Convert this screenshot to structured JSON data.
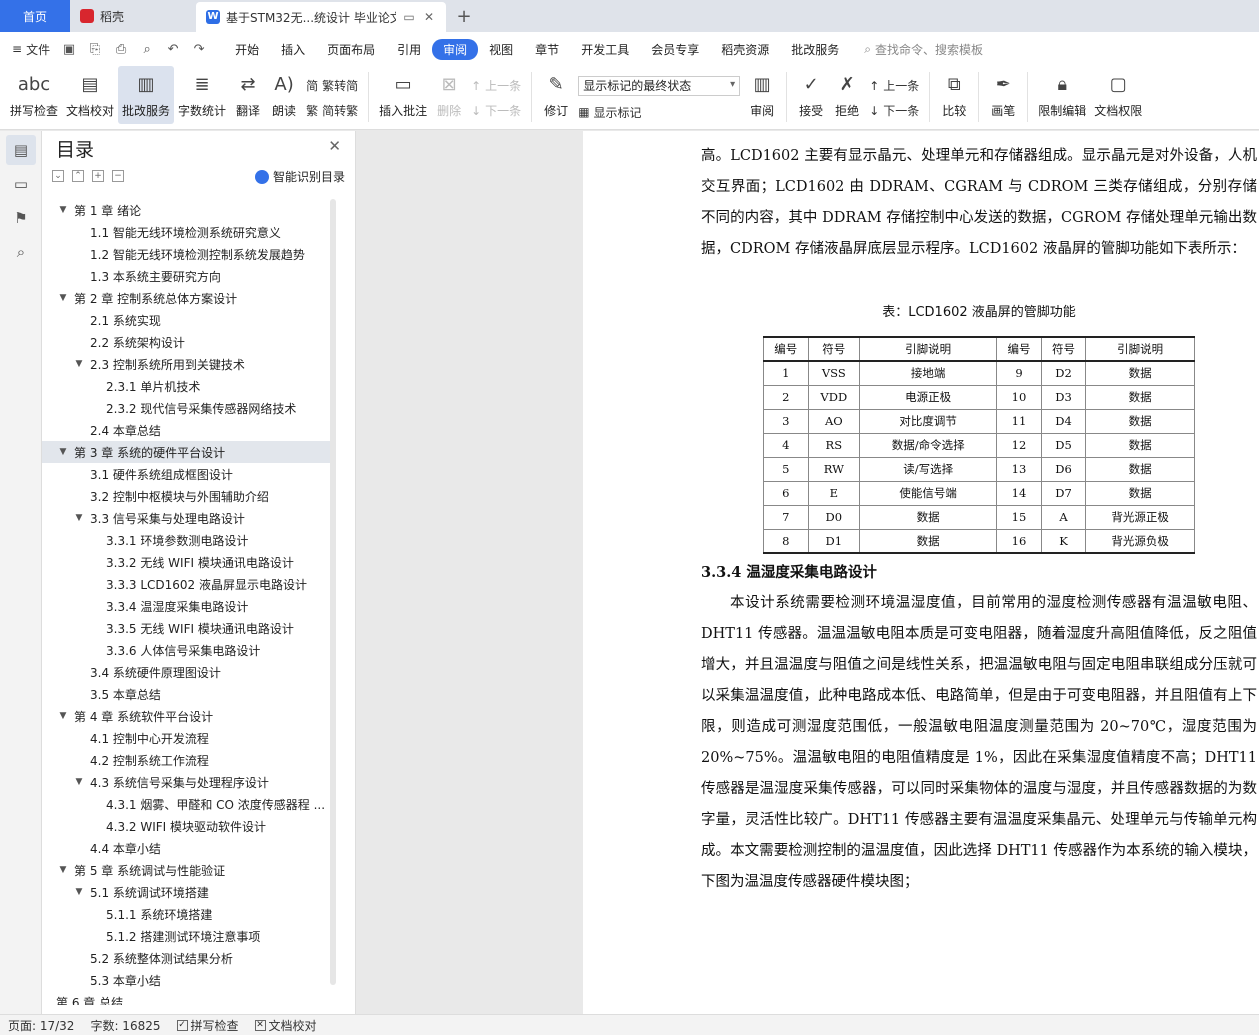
{
  "tabs": {
    "home": "首页",
    "daoke": "稻壳",
    "doc": "基于STM32无...统设计 毕业论文"
  },
  "menu": {
    "file": "文件",
    "tabs": [
      "开始",
      "插入",
      "页面布局",
      "引用",
      "审阅",
      "视图",
      "章节",
      "开发工具",
      "会员专享",
      "稻壳资源",
      "批改服务"
    ],
    "active": "审阅",
    "search": "查找命令、搜索模板"
  },
  "ribbon": {
    "spell": "拼写检查",
    "doc_check": "文档校对",
    "grading": "批改服务",
    "wordcount": "字数统计",
    "translate": "翻译",
    "read": "朗读",
    "trad": "繁转简",
    "simp": "简转繁",
    "insert_comment": "插入批注",
    "delete": "删除",
    "prev": "上一条",
    "next": "下一条",
    "revise": "修订",
    "markup_select": "显示标记的最终状态",
    "show_markup": "显示标记",
    "review": "审阅",
    "accept": "接受",
    "reject": "拒绝",
    "prev2": "上一条",
    "next2": "下一条",
    "compare": "比较",
    "pen": "画笔",
    "restrict": "限制编辑",
    "doc_perm": "文档权限"
  },
  "toc": {
    "title": "目录",
    "smart": "智能识别目录",
    "items": [
      {
        "level": 1,
        "text": "第 1 章  绪论",
        "caret": "v"
      },
      {
        "level": 2,
        "text": "1.1 智能无线环境检测系统研究意义",
        "caret": ""
      },
      {
        "level": 2,
        "text": "1.2 智能无线环境检测控制系统发展趋势",
        "caret": ""
      },
      {
        "level": 2,
        "text": "1.3 本系统主要研究方向",
        "caret": ""
      },
      {
        "level": 1,
        "text": "第 2 章  控制系统总体方案设计",
        "caret": "v"
      },
      {
        "level": 2,
        "text": "2.1 系统实现",
        "caret": ""
      },
      {
        "level": 2,
        "text": "2.2 系统架构设计",
        "caret": ""
      },
      {
        "level": 2,
        "text": "2.3 控制系统所用到关键技术",
        "caret": "v"
      },
      {
        "level": 3,
        "text": "2.3.1 单片机技术",
        "caret": ""
      },
      {
        "level": 3,
        "text": "2.3.2 现代信号采集传感器网络技术",
        "caret": ""
      },
      {
        "level": 2,
        "text": "2.4 本章总结",
        "caret": ""
      },
      {
        "level": 1,
        "text": "第 3 章  系统的硬件平台设计",
        "caret": "v",
        "selected": true
      },
      {
        "level": 2,
        "text": "3.1 硬件系统组成框图设计",
        "caret": ""
      },
      {
        "level": 2,
        "text": "3.2 控制中枢模块与外围辅助介绍",
        "caret": ""
      },
      {
        "level": 2,
        "text": "3.3 信号采集与处理电路设计",
        "caret": "v"
      },
      {
        "level": 3,
        "text": "3.3.1 环境参数测电路设计",
        "caret": ""
      },
      {
        "level": 3,
        "text": "3.3.2 无线 WIFI 模块通讯电路设计",
        "caret": ""
      },
      {
        "level": 3,
        "text": "3.3.3 LCD1602 液晶屏显示电路设计",
        "caret": ""
      },
      {
        "level": 3,
        "text": "3.3.4 温湿度采集电路设计",
        "caret": ""
      },
      {
        "level": 3,
        "text": "3.3.5 无线 WIFI 模块通讯电路设计",
        "caret": ""
      },
      {
        "level": 3,
        "text": "3.3.6 人体信号采集电路设计",
        "caret": ""
      },
      {
        "level": 2,
        "text": "3.4 系统硬件原理图设计",
        "caret": ""
      },
      {
        "level": 2,
        "text": "3.5 本章总结",
        "caret": ""
      },
      {
        "level": 1,
        "text": "第 4 章  系统软件平台设计",
        "caret": "v"
      },
      {
        "level": 2,
        "text": "4.1 控制中心开发流程",
        "caret": ""
      },
      {
        "level": 2,
        "text": "4.2 控制系统工作流程",
        "caret": ""
      },
      {
        "level": 2,
        "text": "4.3 系统信号采集与处理程序设计",
        "caret": "v"
      },
      {
        "level": 3,
        "text": "4.3.1 烟雾、甲醛和 CO 浓度传感器程 ...",
        "caret": ""
      },
      {
        "level": 3,
        "text": "4.3.2 WIFI 模块驱动软件设计",
        "caret": ""
      },
      {
        "level": 2,
        "text": "4.4 本章小结",
        "caret": ""
      },
      {
        "level": 1,
        "text": "第 5 章  系统调试与性能验证",
        "caret": "v"
      },
      {
        "level": 2,
        "text": "5.1 系统调试环境搭建",
        "caret": "v"
      },
      {
        "level": 3,
        "text": "5.1.1 系统环境搭建",
        "caret": ""
      },
      {
        "level": 3,
        "text": "5.1.2 搭建测试环境注意事项",
        "caret": ""
      },
      {
        "level": 2,
        "text": "5.2 系统整体测试结果分析",
        "caret": ""
      },
      {
        "level": 2,
        "text": "5.3 本章小结",
        "caret": ""
      },
      {
        "level": 1,
        "text": "第 6 章  总结",
        "caret": ""
      }
    ]
  },
  "doc": {
    "para1": "高。LCD1602 主要有显示晶元、处理单元和存储器组成。显示晶元是对外设备，人机交互界面；LCD1602 由 DDRAM、CGRAM 与 CDROM 三类存储组成，分别存储不同的内容，其中 DDRAM 存储控制中心发送的数据，CGROM 存储处理单元输出数据，CDROM 存储液晶屏底层显示程序。LCD1602 液晶屏的管脚功能如下表所示：",
    "caption": "表：LCD1602 液晶屏的管脚功能",
    "table_headers": [
      "编号",
      "符号",
      "引脚说明",
      "编号",
      "符号",
      "引脚说明"
    ],
    "table_rows": [
      [
        "1",
        "VSS",
        "接地端",
        "9",
        "D2",
        "数据"
      ],
      [
        "2",
        "VDD",
        "电源正极",
        "10",
        "D3",
        "数据"
      ],
      [
        "3",
        "AO",
        "对比度调节",
        "11",
        "D4",
        "数据"
      ],
      [
        "4",
        "RS",
        "数据/命令选择",
        "12",
        "D5",
        "数据"
      ],
      [
        "5",
        "RW",
        "读/写选择",
        "13",
        "D6",
        "数据"
      ],
      [
        "6",
        "E",
        "使能信号端",
        "14",
        "D7",
        "数据"
      ],
      [
        "7",
        "D0",
        "数据",
        "15",
        "A",
        "背光源正极"
      ],
      [
        "8",
        "D1",
        "数据",
        "16",
        "K",
        "背光源负极"
      ]
    ],
    "heading": "3.3.4 温湿度采集电路设计",
    "para2": "本设计系统需要检测环境温湿度值，目前常用的湿度检测传感器有温温敏电阻、DHT11 传感器。温温温敏电阻本质是可变电阻器，随着湿度升高阻值降低，反之阻值增大，并且温温度与阻值之间是线性关系，把温温敏电阻与固定电阻串联组成分压就可以采集温温度值，此种电路成本低、电路简单，但是由于可变电阻器，并且阻值有上下限，则造成可测湿度范围低，一般温敏电阻温度测量范围为 20~70℃，湿度范围为 20%~75%。温温敏电阻的电阻值精度是 1%，因此在采集湿度值精度不高；DHT11 传感器是温湿度采集传感器，可以同时采集物体的温度与湿度，并且传感器数据的为数字量，灵活性比较广。DHT11 传感器主要有温温度采集晶元、处理单元与传输单元构成。本文需要检测控制的温温度值，因此选择 DHT11 传感器作为本系统的输入模块，下图为温温度传感器硬件模块图；"
  },
  "status": {
    "page": "页面: 17/32",
    "words": "字数: 16825",
    "spell": "拼写检查",
    "check": "文档校对"
  }
}
